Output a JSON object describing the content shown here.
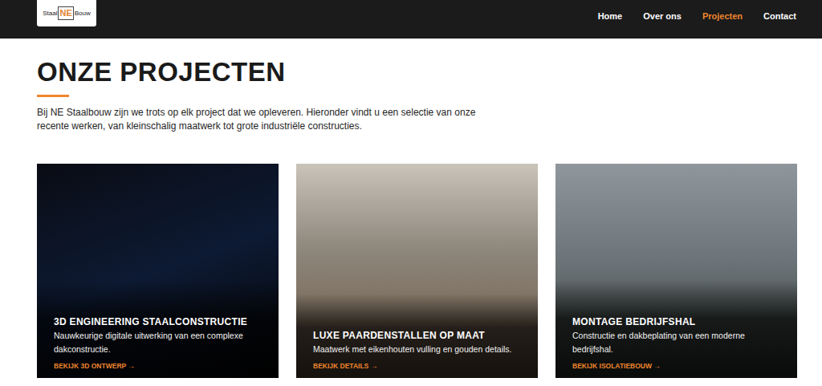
{
  "logo": {
    "left": "Staal",
    "mark": "NE",
    "right": "Bouw"
  },
  "nav": [
    {
      "label": "Home",
      "selected": false
    },
    {
      "label": "Over ons",
      "selected": false
    },
    {
      "label": "Projecten",
      "selected": true
    },
    {
      "label": "Contact",
      "selected": false
    }
  ],
  "page": {
    "title": "ONZE PROJECTEN",
    "intro": "Bij NE Staalbouw zijn we trots op elk project dat we opleveren. Hieronder vindt u een selectie van onze recente werken, van kleinschalig maatwerk tot grote industriële constructies."
  },
  "projects": [
    {
      "title": "3D ENGINEERING STAALCONSTRUCTIE",
      "description": "Nauwkeurige digitale uitwerking van een complexe dakconstructie.",
      "link": "BEKIJK 3D ONTWERP →"
    },
    {
      "title": "LUXE PAARDENSTALLEN OP MAAT",
      "description": "Maatwerk met eikenhouten vulling en gouden details.",
      "link": "BEKIJK DETAILS →"
    },
    {
      "title": "MONTAGE BEDRIJFSHAL",
      "description": "Constructie en dakbeplating van een moderne bedrijfshal.",
      "link": "BEKIJK ISOLATIEBOUW →"
    }
  ]
}
